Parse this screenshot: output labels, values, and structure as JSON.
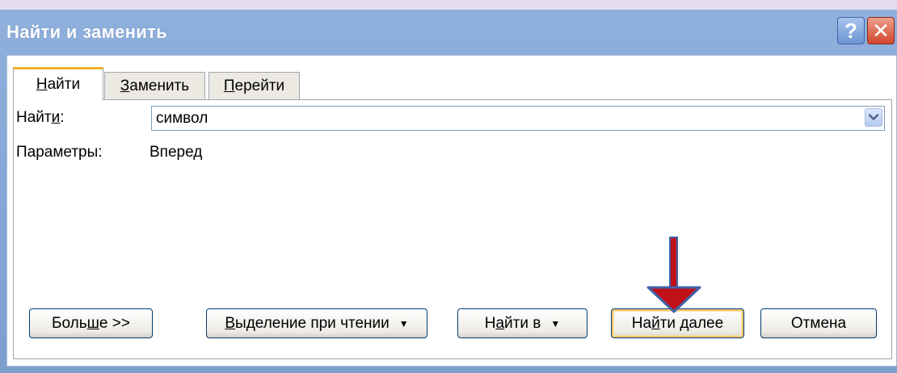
{
  "window": {
    "title": "Найти и заменить",
    "help_glyph": "?",
    "close_glyph": "✕"
  },
  "tabs": [
    {
      "underline": "Н",
      "rest": "айти"
    },
    {
      "underline": "З",
      "rest": "аменить"
    },
    {
      "underline": "П",
      "rest": "ерейти"
    }
  ],
  "find": {
    "label_pre": "Найт",
    "label_underline": "и",
    "label_post": ":",
    "value": "символ"
  },
  "params": {
    "label": "Параметры:",
    "value": "Вперед"
  },
  "buttons": {
    "more": {
      "pre": "Боль",
      "underline": "ш",
      "post": "е >>"
    },
    "reading": {
      "underline": "В",
      "post": "ыделение при чтении",
      "caret": "▼"
    },
    "find_in": {
      "pre": "Н",
      "underline": "а",
      "post": "йти в",
      "caret": "▼"
    },
    "find_next": {
      "pre": "На",
      "underline": "й",
      "post": "ти далее"
    },
    "cancel": "Отмена"
  },
  "colors": {
    "titlebar": "#8fb0dc",
    "arrow_fill": "#c0101a",
    "arrow_outline": "#3f63a8",
    "tab_active_accent": "#f3b030"
  },
  "icons": {
    "help": "help-icon",
    "close": "close-icon",
    "dropdown": "chevron-down-icon",
    "annotation": "down-arrow-annotation"
  }
}
